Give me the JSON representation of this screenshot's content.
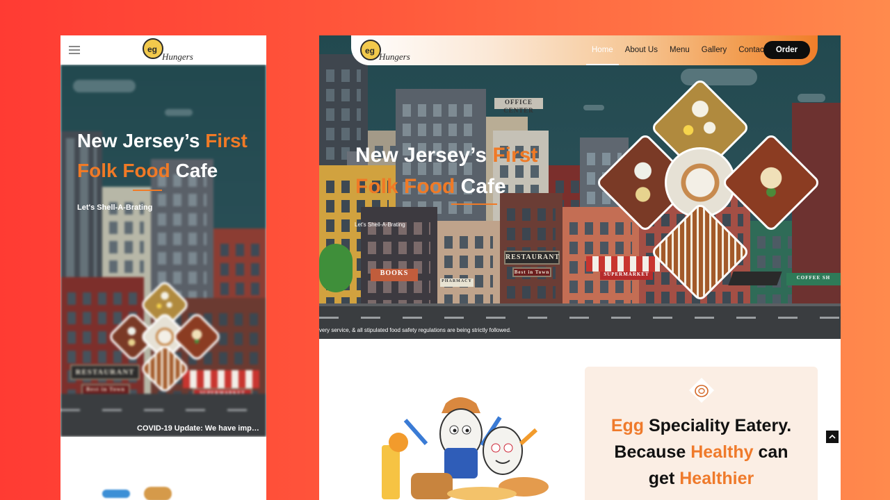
{
  "brand": {
    "logo_text": "Hungers",
    "logo_mark": "egg",
    "accent_color": "#f07a26"
  },
  "mobile": {
    "menu_icon": "hamburger-icon",
    "hero_title_white_1": "New Jersey’s",
    "hero_title_orange_1": "First",
    "hero_title_orange_2": "Folk Food",
    "hero_title_white_2": "Cafe",
    "tagline": "Let's Shell-A-Brating",
    "ticker": "COVID-19 Update: We have imp…"
  },
  "desktop": {
    "nav": {
      "items": [
        "Home",
        "About Us",
        "Menu",
        "Gallery",
        "Contact Us"
      ],
      "active": "Home",
      "order_label": "Order"
    },
    "hero": {
      "title_white_1": "New Jersey’s",
      "title_orange_1": "First",
      "title_orange_2": "Folk Food",
      "title_white_2": "Cafe",
      "tagline": "Let's Shell-A-Brating",
      "ticker": "very service, & all stipulated food safety regulations are being strictly followed.",
      "signs": {
        "office": "OFFICE CENTER",
        "restaurant": "RESTAURANT",
        "best_in_town": "Best in Town",
        "books": "BOOKS",
        "pharmacy": "PHARMACY",
        "supermarket": "SUPERMARKET",
        "coffee": "COFFEE SH"
      }
    },
    "feature": {
      "line1_orange": "Egg",
      "line1_dark": "Speciality Eatery.",
      "line2_dark": "Because",
      "line2_orange": "Healthy",
      "line2_dark_2": "can",
      "line3_dark": "get",
      "line3_orange": "Healthier"
    }
  },
  "mobile_signs": {
    "restaurant": "RESTAURANT",
    "best_in_town": "Best in Town",
    "supermarket": "SUPERMARKET"
  }
}
